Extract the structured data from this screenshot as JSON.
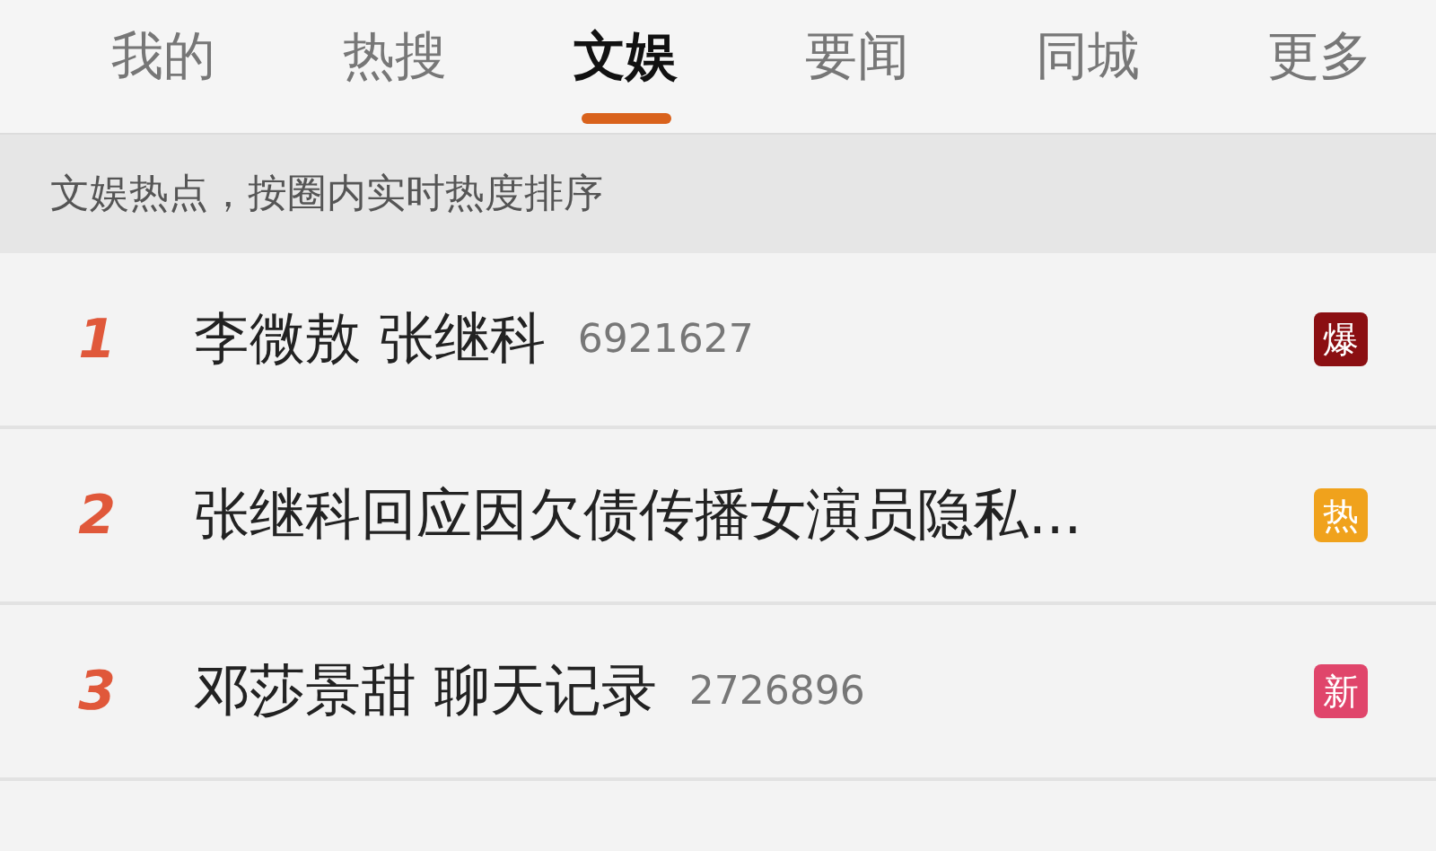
{
  "tabs": [
    {
      "label": "我的",
      "selected": false
    },
    {
      "label": "热搜",
      "selected": false
    },
    {
      "label": "文娱",
      "selected": true
    },
    {
      "label": "要闻",
      "selected": false
    },
    {
      "label": "同城",
      "selected": false
    },
    {
      "label": "更多",
      "selected": false
    }
  ],
  "subheader": "文娱热点，按圈内实时热度排序",
  "rows": [
    {
      "rank": "1",
      "title": "李微敖 张继科",
      "count": "6921627",
      "badge": {
        "text": "爆",
        "color": "#8b0f12"
      }
    },
    {
      "rank": "2",
      "title": "张继科回应因欠债传播女演员隐私...",
      "badge": {
        "text": "热",
        "color": "#f0a21c"
      }
    },
    {
      "rank": "3",
      "title": "邓莎景甜 聊天记录",
      "count": "2726896",
      "badge": {
        "text": "新",
        "color": "#e0456b"
      }
    }
  ]
}
